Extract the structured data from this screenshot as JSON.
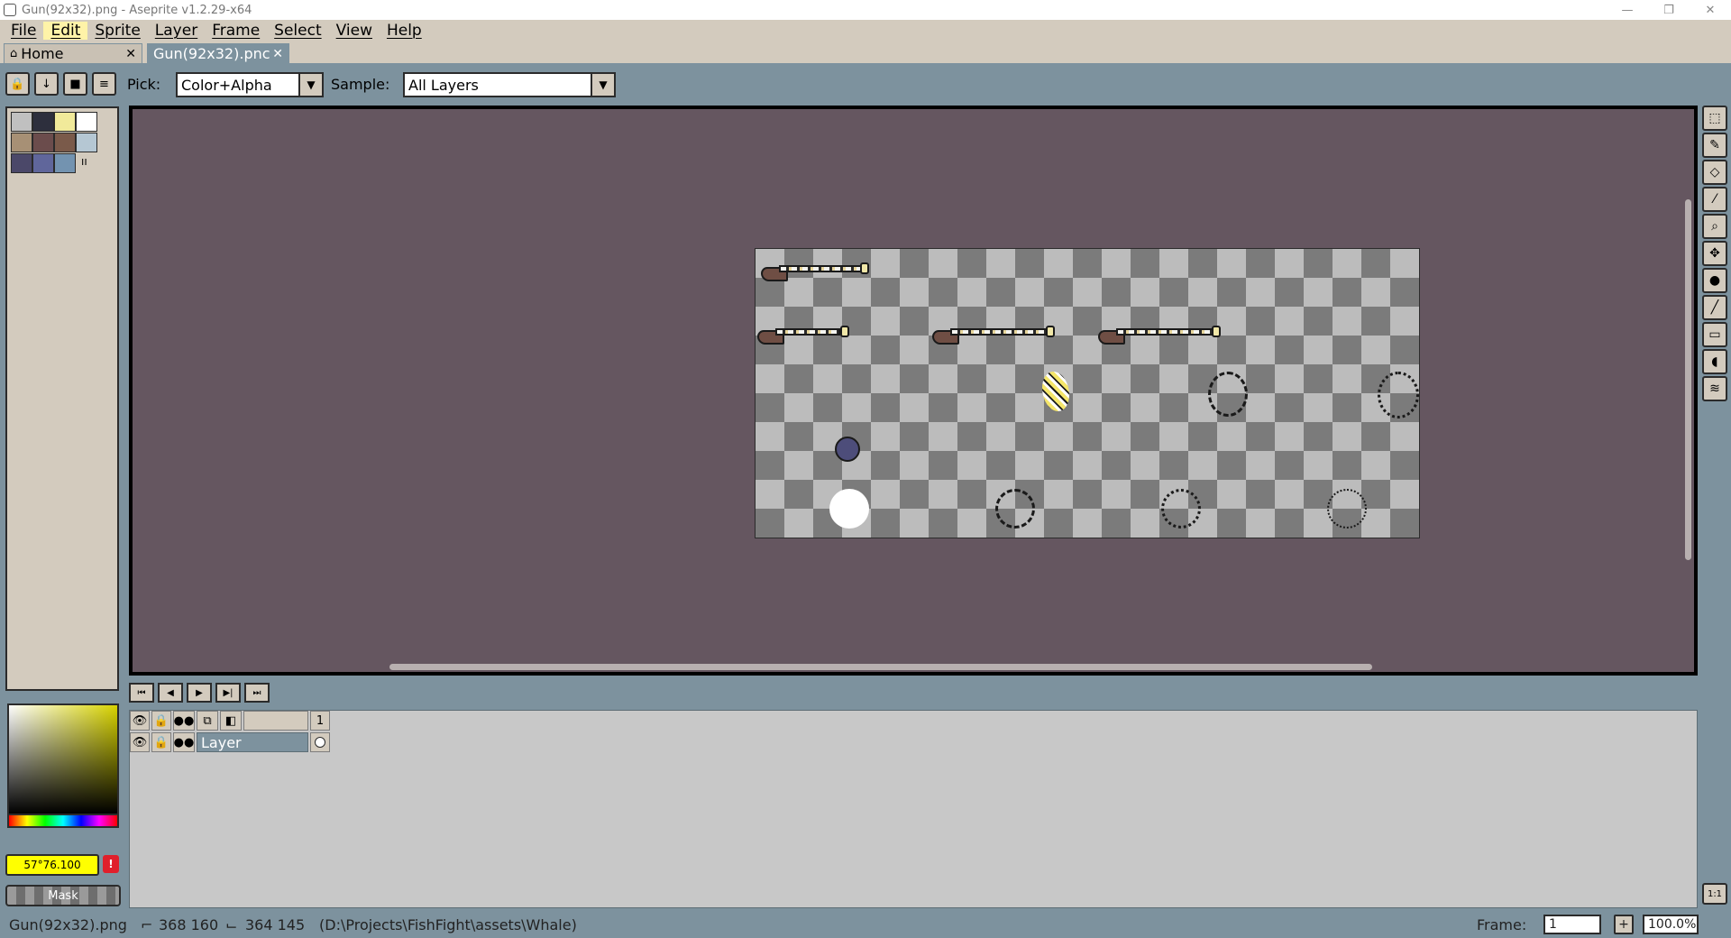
{
  "window": {
    "title": "Gun(92x32).png - Aseprite v1.2.29-x64",
    "controls": [
      "—",
      "❐",
      "✕"
    ]
  },
  "menu": [
    "File",
    "Edit",
    "Sprite",
    "Layer",
    "Frame",
    "Select",
    "View",
    "Help"
  ],
  "tabs": {
    "home": "Home",
    "doc": "Gun(92x32).pnc"
  },
  "context": {
    "pick_label": "Pick:",
    "pick_value": "Color+Alpha",
    "sample_label": "Sample:",
    "sample_value": "All Layers"
  },
  "palette": {
    "colors": [
      "#c0c0c0",
      "#2d2f3d",
      "#f1ea9a",
      "#ffffff",
      "#a79075",
      "#6b4c4c",
      "#7a5a4a",
      "#b5c7d3",
      "#4b4869",
      "#60669b",
      "#7393b0"
    ],
    "count_label": "ıı"
  },
  "color_picker": {
    "value": "57°76.100",
    "mask_label": "Mask"
  },
  "timeline": {
    "frame_header": "1",
    "layer_name": "Layer"
  },
  "status": {
    "filename": "Gun(92x32).png",
    "cursor_pos": "368 160",
    "selection_size": "364 145",
    "path": "(D:\\Projects\\FishFight\\assets\\Whale)",
    "frame_label": "Frame:",
    "frame_value": "1",
    "zoom_value": "100.0%",
    "add_label": "+"
  }
}
